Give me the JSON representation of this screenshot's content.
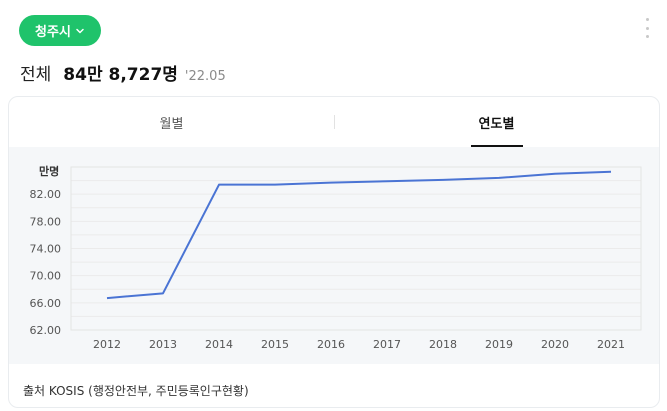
{
  "header": {
    "region": "청주시",
    "region_icon": "chevron-down-icon",
    "more_icon": "more-vertical-icon"
  },
  "summary": {
    "label": "전체",
    "value": "84만 8,727명",
    "date": "'22.05"
  },
  "tabs": [
    {
      "label": "월별",
      "active": false
    },
    {
      "label": "연도별",
      "active": true
    }
  ],
  "chart_data": {
    "type": "line",
    "unit_label": "만명",
    "x": [
      "2012",
      "2013",
      "2014",
      "2015",
      "2016",
      "2017",
      "2018",
      "2019",
      "2020",
      "2021"
    ],
    "series": [
      {
        "values": [
          66.7,
          67.4,
          83.4,
          83.4,
          83.7,
          83.9,
          84.1,
          84.4,
          85.0,
          85.3
        ]
      }
    ],
    "yticks": [
      "62.00",
      "66.00",
      "70.00",
      "74.00",
      "78.00",
      "82.00"
    ],
    "ylim": [
      62,
      86
    ],
    "grid": true,
    "colors": {
      "line": "#4a74d4",
      "grid": "#ebebeb",
      "background": "#f5f7f9"
    }
  },
  "footer": {
    "source": "출처 KOSIS (행정안전부, 주민등록인구현황)"
  },
  "colors": {
    "accent": "#1fc36b"
  }
}
